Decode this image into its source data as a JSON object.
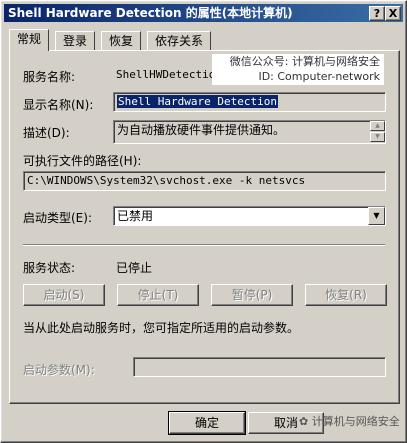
{
  "window": {
    "title": "Shell Hardware Detection 的属性(本地计算机)",
    "help_btn": "?",
    "close_btn": "X"
  },
  "tabs": [
    "常规",
    "登录",
    "恢复",
    "依存关系"
  ],
  "general": {
    "service_name_label": "服务名称:",
    "service_name": "ShellHWDetection",
    "display_name_label": "显示名称(N):",
    "display_name": "Shell Hardware Detection",
    "description_label": "描述(D):",
    "description": "为自动播放硬件事件提供通知。",
    "exe_path_label": "可执行文件的路径(H):",
    "exe_path": "C:\\WINDOWS\\System32\\svchost.exe -k netsvcs",
    "startup_type_label": "启动类型(E):",
    "startup_type": "已禁用",
    "status_label": "服务状态:",
    "status": "已停止",
    "start_btn": "启动(S)",
    "stop_btn": "停止(T)",
    "pause_btn": "暂停(P)",
    "resume_btn": "恢复(R)",
    "hint": "当从此处启动服务时，您可指定所适用的启动参数。",
    "params_label": "启动参数(M):",
    "params_value": ""
  },
  "footer": {
    "ok": "确定",
    "cancel": "取消"
  },
  "watermark": {
    "line1": "微信公众号: 计算机与网络安全",
    "line2": "ID: Computer-network",
    "bottom": "计算机与网络安全"
  }
}
